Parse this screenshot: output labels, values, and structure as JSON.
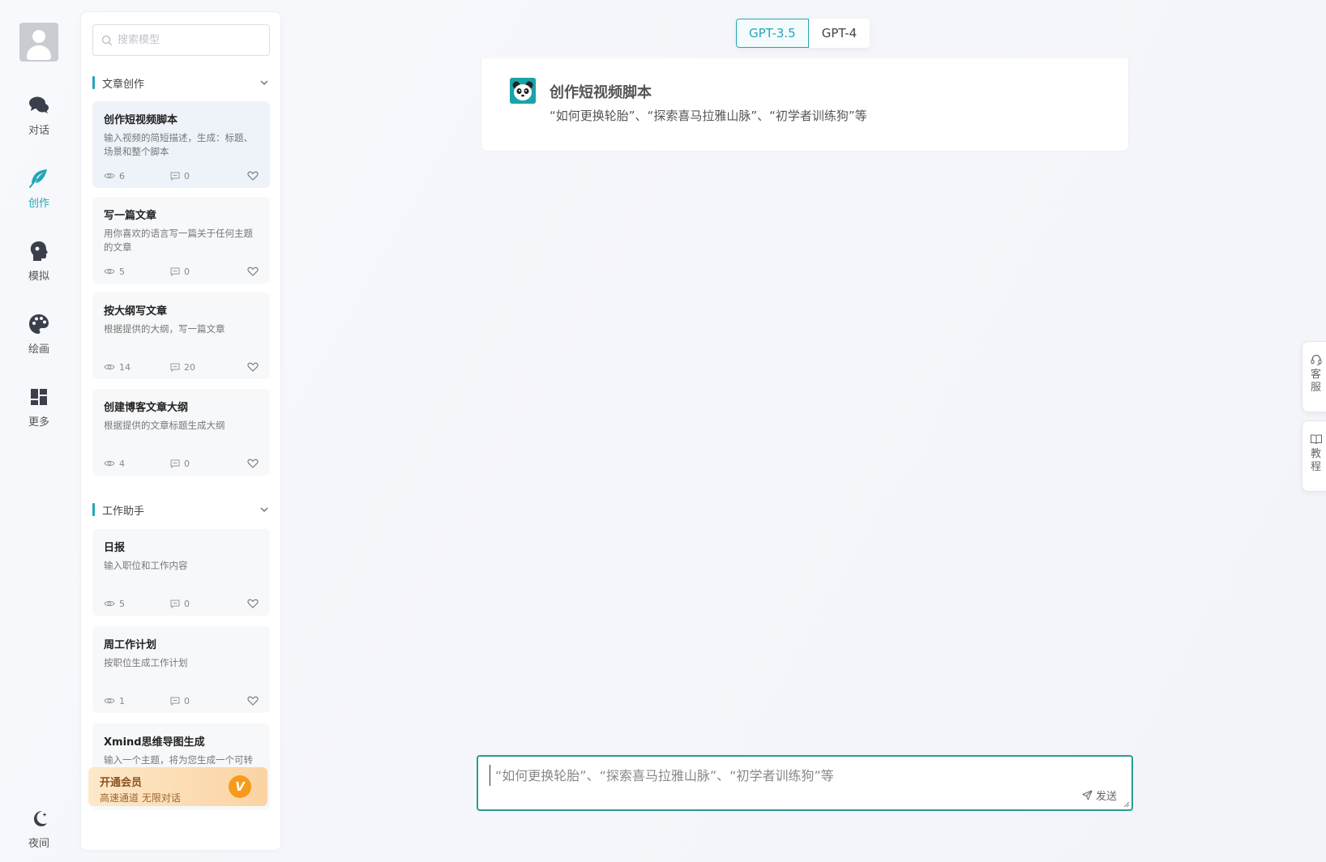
{
  "nav": {
    "items": [
      {
        "label": "对话",
        "icon": "chat-icon"
      },
      {
        "label": "创作",
        "icon": "feather-icon"
      },
      {
        "label": "模拟",
        "icon": "head-icon"
      },
      {
        "label": "绘画",
        "icon": "palette-icon"
      },
      {
        "label": "更多",
        "icon": "grid-icon"
      }
    ],
    "active": "创作",
    "night_label": "夜间"
  },
  "search": {
    "placeholder": "搜索模型"
  },
  "sections": [
    {
      "title": "文章创作",
      "cards": [
        {
          "title": "创作短视频脚本",
          "desc": "输入视频的简短描述，生成：标题、场景和整个脚本",
          "views": "6",
          "comments": "0",
          "selected": true
        },
        {
          "title": "写一篇文章",
          "desc": "用你喜欢的语言写一篇关于任何主题的文章",
          "views": "5",
          "comments": "0"
        },
        {
          "title": "按大纲写文章",
          "desc": "根据提供的大纲，写一篇文章",
          "views": "14",
          "comments": "20"
        },
        {
          "title": "创建博客文章大纲",
          "desc": "根据提供的文章标题生成大纲",
          "views": "4",
          "comments": "0"
        }
      ]
    },
    {
      "title": "工作助手",
      "cards": [
        {
          "title": "日报",
          "desc": "输入职位和工作内容",
          "views": "5",
          "comments": "0"
        },
        {
          "title": "周工作计划",
          "desc": "按职位生成工作计划",
          "views": "1",
          "comments": "0"
        },
        {
          "title": "Xmind思维导图生成",
          "desc": "输入一个主题，将为您生成一个可转换为XMIND的文档",
          "views": "",
          "comments": ""
        }
      ]
    }
  ],
  "vip": {
    "title": "开通会员",
    "subtitle": "高速通道 无限对话",
    "badge": "V"
  },
  "model_toggle": {
    "options": [
      "GPT-3.5",
      "GPT-4"
    ],
    "selected": "GPT-3.5"
  },
  "intro": {
    "title": "创作短视频脚本",
    "subtitle": "“如何更换轮胎”、“探索喜马拉雅山脉”、“初学者训练狗”等"
  },
  "composer": {
    "placeholder": "“如何更换轮胎”、“探索喜马拉雅山脉”、“初学者训练狗”等",
    "send_label": "发送"
  },
  "float": {
    "service_label": "客服",
    "tutorial_label": "教程"
  },
  "colors": {
    "accent": "#25a6b6",
    "composer_border": "#2a9d8f",
    "vip_badge": "#f79a1b"
  }
}
